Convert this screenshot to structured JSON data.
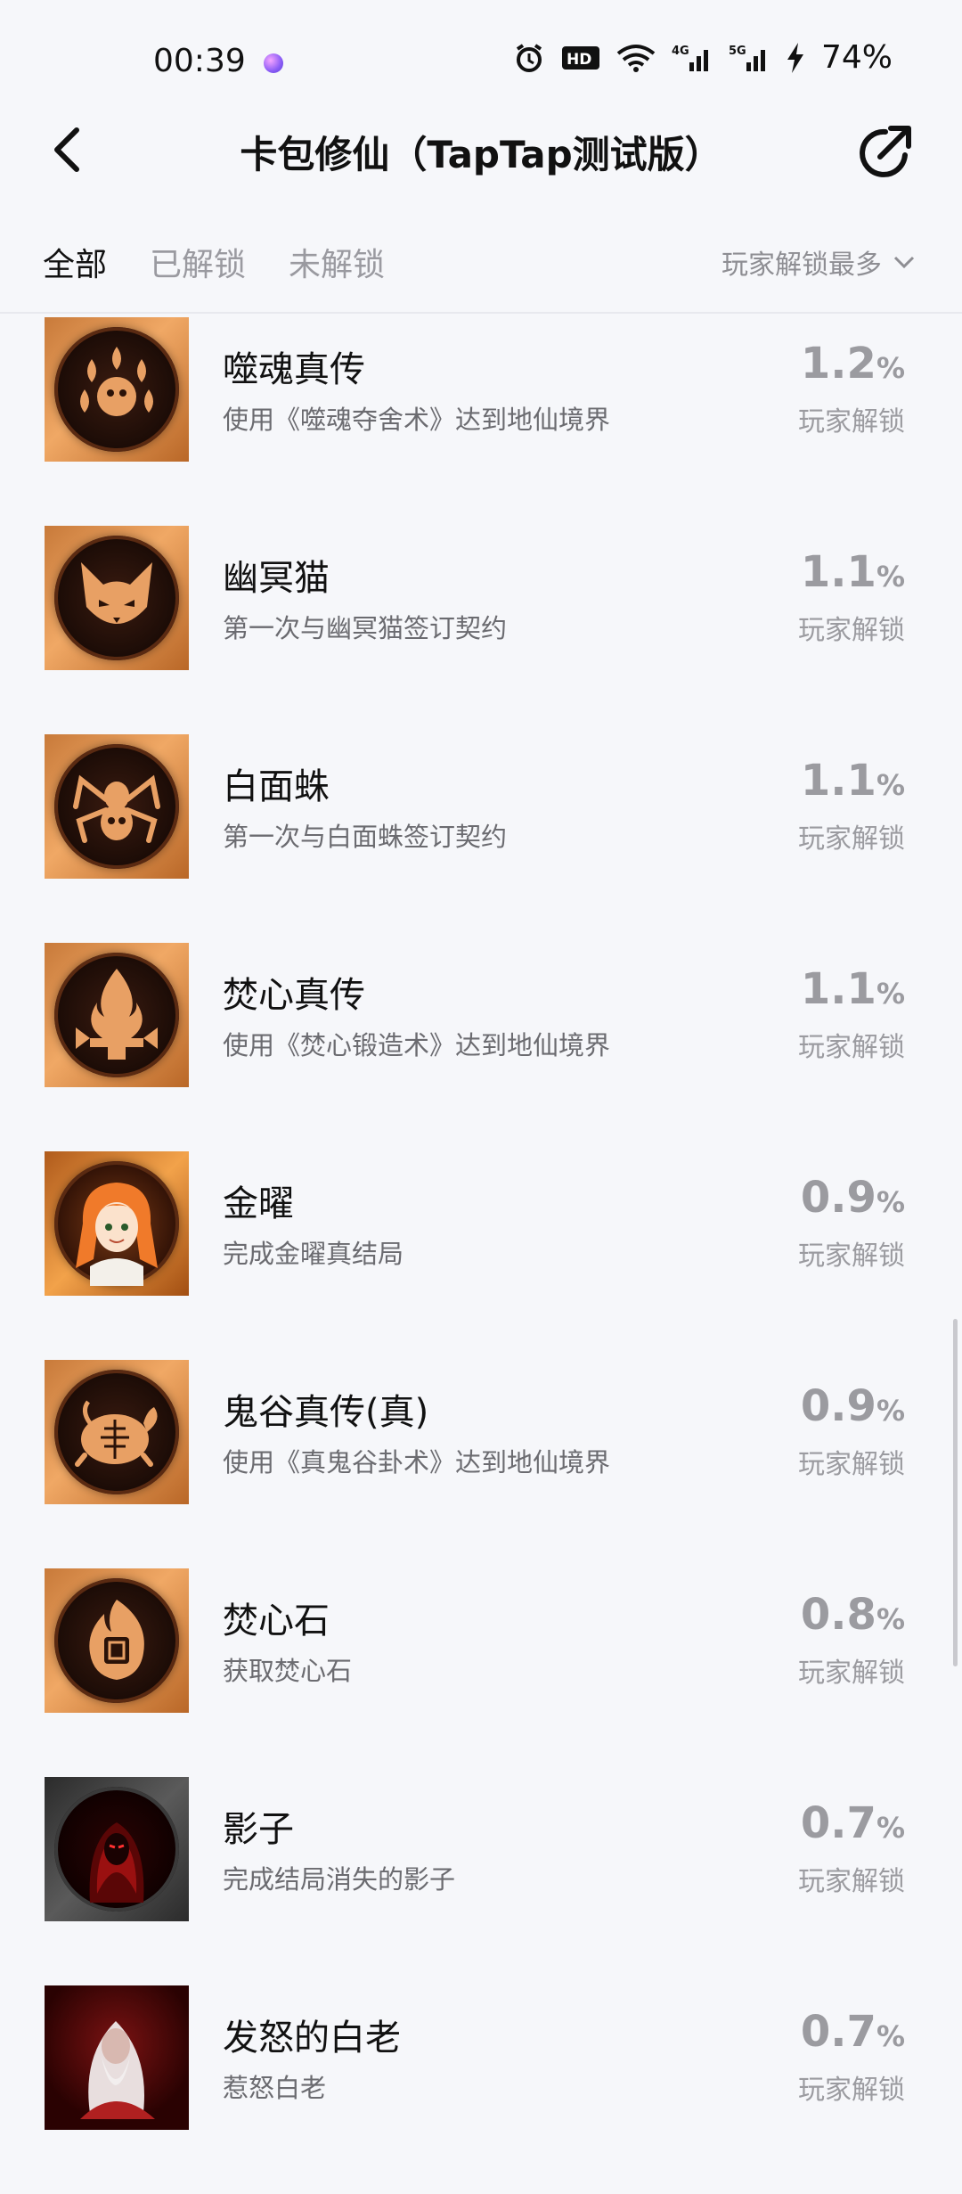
{
  "status_bar": {
    "time": "00:39",
    "battery": "74%"
  },
  "header": {
    "title": "卡包修仙（TapTap测试版）"
  },
  "tabs": [
    {
      "label": "全部",
      "active": true
    },
    {
      "label": "已解锁",
      "active": false
    },
    {
      "label": "未解锁",
      "active": false
    }
  ],
  "sort": {
    "label": "玩家解锁最多"
  },
  "achievements": [
    {
      "name": "噬魂真传",
      "desc": "使用《噬魂夺舍术》达到地仙境界",
      "percent": "1.2",
      "unit": "%",
      "label": "玩家解锁",
      "icon": "soul-flames-icon"
    },
    {
      "name": "幽冥猫",
      "desc": "第一次与幽冥猫签订契约",
      "percent": "1.1",
      "unit": "%",
      "label": "玩家解锁",
      "icon": "cat-icon"
    },
    {
      "name": "白面蛛",
      "desc": "第一次与白面蛛签订契约",
      "percent": "1.1",
      "unit": "%",
      "label": "玩家解锁",
      "icon": "spider-icon"
    },
    {
      "name": "焚心真传",
      "desc": "使用《焚心锻造术》达到地仙境界",
      "percent": "1.1",
      "unit": "%",
      "label": "玩家解锁",
      "icon": "forge-flame-icon"
    },
    {
      "name": "金曜",
      "desc": "完成金曜真结局",
      "percent": "0.9",
      "unit": "%",
      "label": "玩家解锁",
      "icon": "portrait-jinyao-icon"
    },
    {
      "name": "鬼谷真传(真)",
      "desc": "使用《真鬼谷卦术》达到地仙境界",
      "percent": "0.9",
      "unit": "%",
      "label": "玩家解锁",
      "icon": "turtle-icon"
    },
    {
      "name": "焚心石",
      "desc": "获取焚心石",
      "percent": "0.8",
      "unit": "%",
      "label": "玩家解锁",
      "icon": "flame-stone-icon"
    },
    {
      "name": "影子",
      "desc": "完成结局消失的影子",
      "percent": "0.7",
      "unit": "%",
      "label": "玩家解锁",
      "icon": "shadow-portrait-icon"
    },
    {
      "name": "发怒的白老",
      "desc": "惹怒白老",
      "percent": "0.7",
      "unit": "%",
      "label": "玩家解锁",
      "icon": "white-elder-portrait-icon"
    }
  ]
}
